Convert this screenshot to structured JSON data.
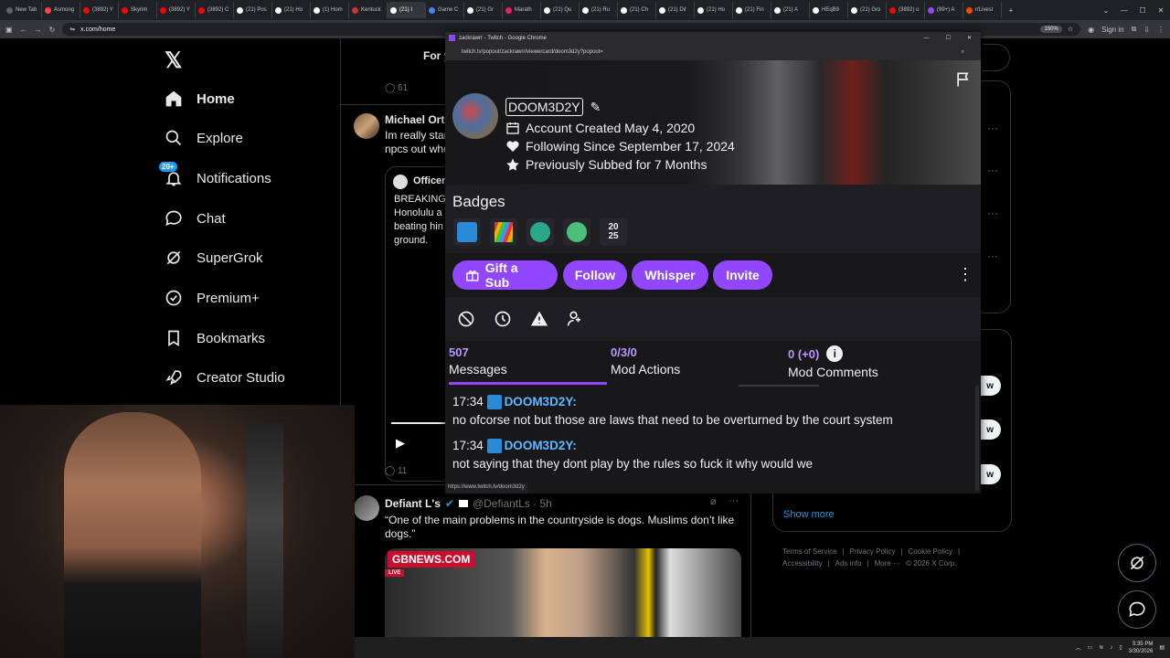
{
  "browser": {
    "tabs": [
      {
        "label": "New Tab",
        "color": "#5f6368"
      },
      {
        "label": "Asmong",
        "color": "#ff4444"
      },
      {
        "label": "(3892) Y",
        "color": "#ff0000"
      },
      {
        "label": "Skyrim",
        "color": "#ff0000"
      },
      {
        "label": "(3892) Y",
        "color": "#ff0000"
      },
      {
        "label": "(3892) C",
        "color": "#ff0000"
      },
      {
        "label": "(21) Pos",
        "color": "#ffffff"
      },
      {
        "label": "(21) Ho",
        "color": "#ffffff"
      },
      {
        "label": "(1) Hom",
        "color": "#ffffff"
      },
      {
        "label": "Kentuck",
        "color": "#c33"
      },
      {
        "label": "(21) I",
        "color": "#ffffff"
      },
      {
        "label": "Game C",
        "color": "#4285f4"
      },
      {
        "label": "(21) Gr",
        "color": "#ffffff"
      },
      {
        "label": "Marath",
        "color": "#e91e63"
      },
      {
        "label": "(21) Qu",
        "color": "#ffffff"
      },
      {
        "label": "(21) Ru",
        "color": "#ffffff"
      },
      {
        "label": "(21) Ch",
        "color": "#ffffff"
      },
      {
        "label": "(21) Dir",
        "color": "#ffffff"
      },
      {
        "label": "(21) Ho",
        "color": "#ffffff"
      },
      {
        "label": "(21) Fin",
        "color": "#ffffff"
      },
      {
        "label": "(21) A",
        "color": "#ffffff"
      },
      {
        "label": "HEqB9",
        "color": "#ffffff"
      },
      {
        "label": "(21) Gro",
        "color": "#ffffff"
      },
      {
        "label": "(3892) o",
        "color": "#ff0000"
      },
      {
        "label": "(99+) A",
        "color": "#9146ff"
      },
      {
        "label": "r/Livest",
        "color": "#ff4500"
      }
    ],
    "new_tab": "+",
    "url": "x.com/home",
    "zoom": "150%",
    "sign_in": "Sign in"
  },
  "x_nav": {
    "logo": "𝕏",
    "items": [
      {
        "label": "Home"
      },
      {
        "label": "Explore"
      },
      {
        "label": "Notifications",
        "badge": "20+"
      },
      {
        "label": "Chat"
      },
      {
        "label": "SuperGrok"
      },
      {
        "label": "Premium+"
      },
      {
        "label": "Bookmarks"
      },
      {
        "label": "Creator Studio"
      }
    ]
  },
  "feed": {
    "tab_for_you": "For y",
    "reply_count_top": "61",
    "tweet1": {
      "author": "Michael Orth",
      "text": "Im really star\nnpcs out whe",
      "quoted_author": "Officer",
      "quoted_text": "BREAKING\nHonolulu a\nbeating hin\nground."
    },
    "reply_count_mid": "11",
    "tweet2": {
      "author": "Defiant L's",
      "handle": "@DefiantLs · 5h",
      "text": "“One of the main problems in the countryside is dogs. Muslims don’t like dogs.”",
      "news_brand": "GBNEWS.COM",
      "live": "LIVE"
    }
  },
  "popup": {
    "window_title": "zackrawrr - Twitch - Google Chrome",
    "url": "twitch.tv/popout/zackrawrr/viewercard/doom3d2y?popout=",
    "username": "DOOM3D2Y",
    "account_created": "Account Created May 4, 2020",
    "following_since": "Following Since September 17, 2024",
    "previously_subbed": "Previously Subbed for 7 Months",
    "badges_title": "Badges",
    "badge_year_top": "20",
    "badge_year_bottom": "25",
    "buttons": {
      "gift": "Gift a Sub",
      "follow": "Follow",
      "whisper": "Whisper",
      "invite": "Invite"
    },
    "stats": [
      {
        "num": "507",
        "label": "Messages"
      },
      {
        "num": "0/3/0",
        "label": "Mod Actions"
      },
      {
        "num": "0 (+0)",
        "label": "Mod Comments"
      }
    ],
    "messages": [
      {
        "time": "17:34",
        "user": "DOOM3D2Y:",
        "text": "no ofcorse not but those are laws that need to be overturned by the court system"
      },
      {
        "time": "17:34",
        "user": "DOOM3D2Y:",
        "text": "not saying that they dont play by the rules so fuck it why would we"
      }
    ],
    "status_url": "https://www.twitch.tv/doom3d2y"
  },
  "right": {
    "show_more": "Show more",
    "follow_label": "w",
    "footer": [
      "Terms of Service",
      "Privacy Policy",
      "Cookie Policy",
      "Accessibility",
      "Ads info",
      "More ···",
      "© 2026 X Corp."
    ]
  },
  "taskbar": {
    "time": "5:35 PM",
    "date": "3/30/2026"
  }
}
